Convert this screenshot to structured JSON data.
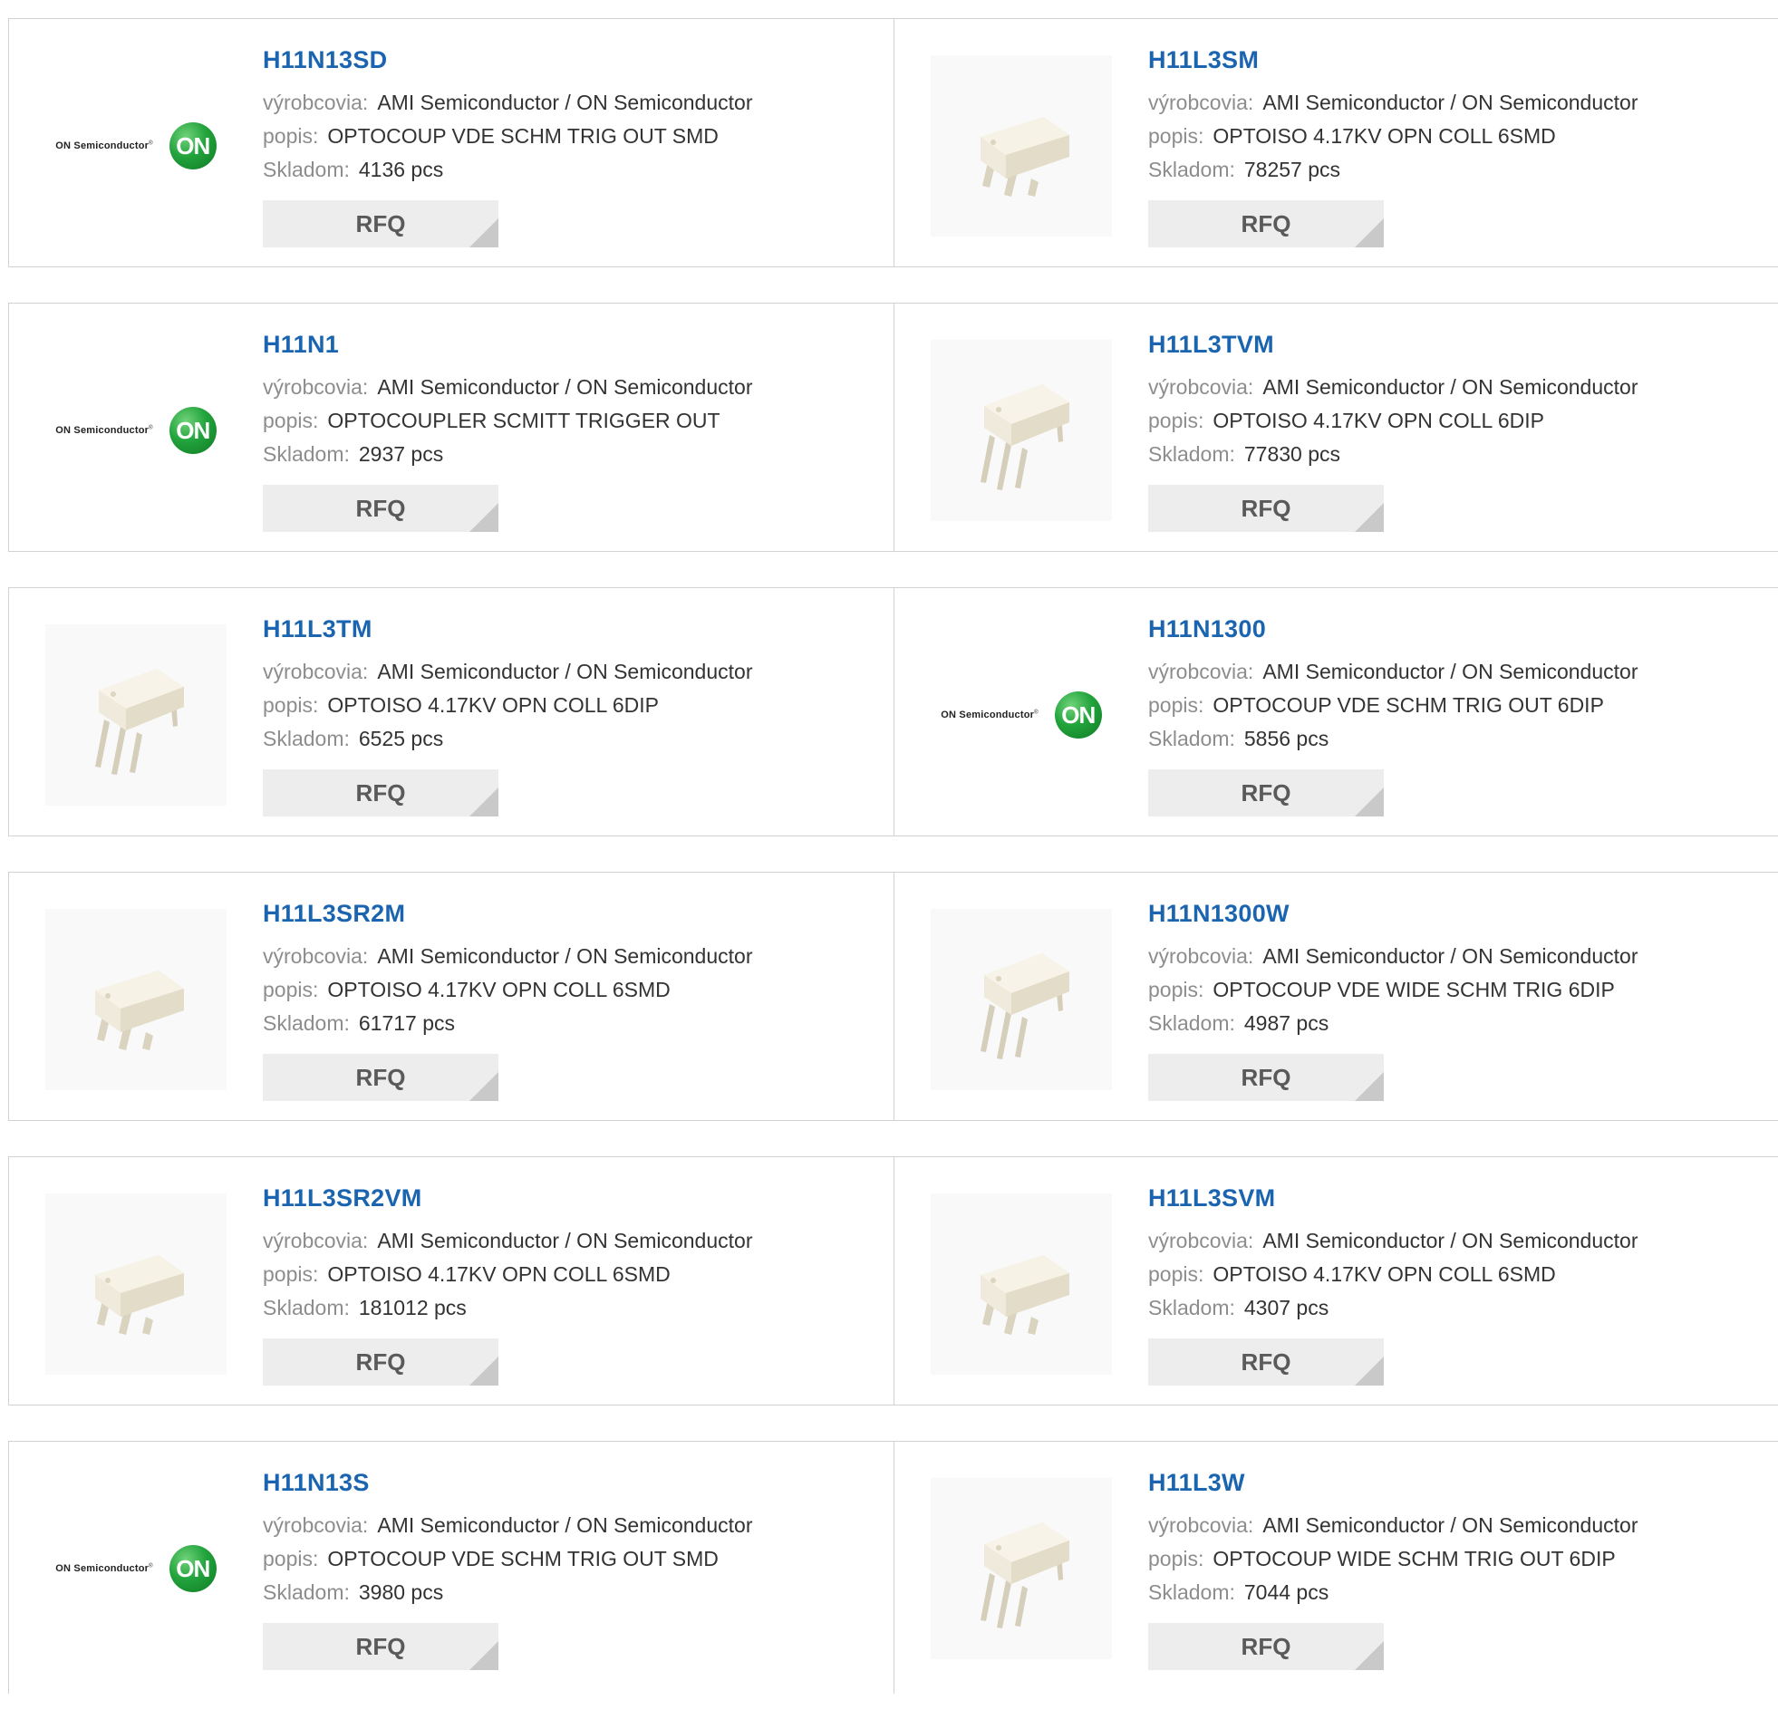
{
  "labels": {
    "manufacturer": "výrobcovia:",
    "description": "popis:",
    "stock": "Skladom:",
    "rfq": "RFQ"
  },
  "logo": {
    "wordmark": "ON Semiconductor",
    "reg": "®",
    "badge": "ON",
    "badge_color": "#22a33c"
  },
  "colors": {
    "part_link": "#1a64b0",
    "label": "#8d8d8d",
    "button_bg": "#ededed"
  },
  "rows": [
    [
      {
        "part": "H11N13SD",
        "manufacturer": "AMI Semiconductor / ON Semiconductor",
        "description": "OPTOCOUP VDE SCHM TRIG OUT SMD",
        "stock": "4136 pcs",
        "image": "on-semiconductor-logo"
      },
      {
        "part": "H11L3SM",
        "manufacturer": "AMI Semiconductor / ON Semiconductor",
        "description": "OPTOISO 4.17KV OPN COLL 6SMD",
        "stock": "78257 pcs",
        "image": "smd-chip"
      }
    ],
    [
      {
        "part": "H11N1",
        "manufacturer": "AMI Semiconductor / ON Semiconductor",
        "description": "OPTOCOUPLER SCMITT TRIGGER OUT",
        "stock": "2937 pcs",
        "image": "on-semiconductor-logo"
      },
      {
        "part": "H11L3TVM",
        "manufacturer": "AMI Semiconductor / ON Semiconductor",
        "description": "OPTOISO 4.17KV OPN COLL 6DIP",
        "stock": "77830 pcs",
        "image": "dip-chip"
      }
    ],
    [
      {
        "part": "H11L3TM",
        "manufacturer": "AMI Semiconductor / ON Semiconductor",
        "description": "OPTOISO 4.17KV OPN COLL 6DIP",
        "stock": "6525 pcs",
        "image": "dip-chip"
      },
      {
        "part": "H11N1300",
        "manufacturer": "AMI Semiconductor / ON Semiconductor",
        "description": "OPTOCOUP VDE SCHM TRIG OUT 6DIP",
        "stock": "5856 pcs",
        "image": "on-semiconductor-logo"
      }
    ],
    [
      {
        "part": "H11L3SR2M",
        "manufacturer": "AMI Semiconductor / ON Semiconductor",
        "description": "OPTOISO 4.17KV OPN COLL 6SMD",
        "stock": "61717 pcs",
        "image": "smd-chip"
      },
      {
        "part": "H11N1300W",
        "manufacturer": "AMI Semiconductor / ON Semiconductor",
        "description": "OPTOCOUP VDE WIDE SCHM TRIG 6DIP",
        "stock": "4987 pcs",
        "image": "dip-chip"
      }
    ],
    [
      {
        "part": "H11L3SR2VM",
        "manufacturer": "AMI Semiconductor / ON Semiconductor",
        "description": "OPTOISO 4.17KV OPN COLL 6SMD",
        "stock": "181012 pcs",
        "image": "smd-chip"
      },
      {
        "part": "H11L3SVM",
        "manufacturer": "AMI Semiconductor / ON Semiconductor",
        "description": "OPTOISO 4.17KV OPN COLL 6SMD",
        "stock": "4307 pcs",
        "image": "smd-chip"
      }
    ],
    [
      {
        "part": "H11N13S",
        "manufacturer": "AMI Semiconductor / ON Semiconductor",
        "description": "OPTOCOUP VDE SCHM TRIG OUT SMD",
        "stock": "3980 pcs",
        "image": "on-semiconductor-logo"
      },
      {
        "part": "H11L3W",
        "manufacturer": "AMI Semiconductor / ON Semiconductor",
        "description": "OPTOCOUP WIDE SCHM TRIG OUT 6DIP",
        "stock": "7044 pcs",
        "image": "dip-chip"
      }
    ]
  ]
}
